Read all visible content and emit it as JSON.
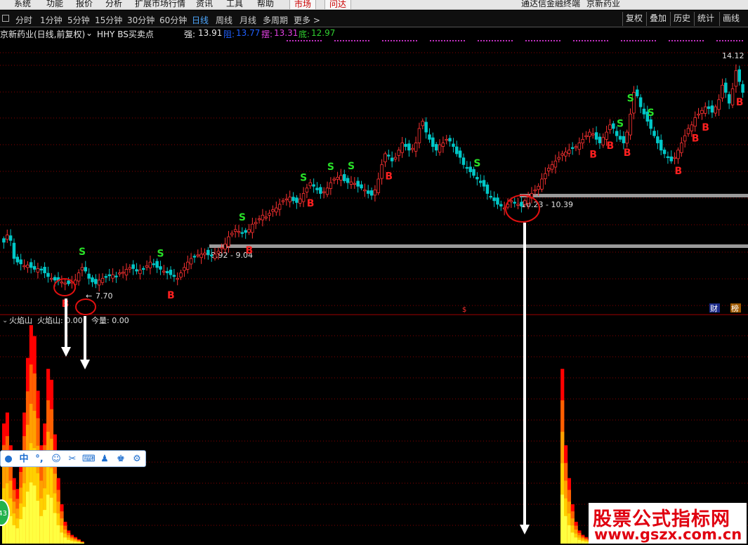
{
  "menu": {
    "items": [
      "系统",
      "功能",
      "报价",
      "分析",
      "扩展市场行情",
      "资讯",
      "工具",
      "帮助"
    ],
    "tabs": [
      "市场",
      "问达"
    ],
    "app_title": "通达信金融终端",
    "stock_name": "京新药业"
  },
  "period_bar": {
    "periods": [
      "分时",
      "1分钟",
      "5分钟",
      "15分钟",
      "30分钟",
      "60分钟",
      "日线",
      "周线",
      "月线",
      "多周期",
      "更多 >"
    ],
    "active": "日线",
    "tools": [
      "复权",
      "叠加",
      "历史",
      "统计",
      "画线"
    ]
  },
  "info": {
    "title": "京新药业(日线,前复权)",
    "indicator": "HHY BS买卖点",
    "strong_label": "强:",
    "strong_value": "13.91",
    "resist_label": "阻:",
    "resist_value": "13.77",
    "swing_label": "摆:",
    "swing_value": "13.31",
    "bottom_label": "底:",
    "bottom_value": "12.97"
  },
  "price_chart": {
    "high_label": "14.12",
    "low_label": "7.70",
    "zones": [
      {
        "label": "8.92 - 9.04"
      },
      {
        "label": "10.23 - 10.39"
      }
    ],
    "signal_marks": {
      "buy": "B",
      "sell": "S"
    },
    "dollar_mark": "$",
    "finance_badge": "财",
    "rank_badge": "榜"
  },
  "lower_panel": {
    "name": "火焰山",
    "line_label": "火焰山: 0.00",
    "volume_label": "今量: 0.00"
  },
  "watermark": {
    "title": "股票公式指标网",
    "url": "www.gszx.com.cn"
  },
  "float_toolbar": {
    "ball_text": "43",
    "middle_label": "中"
  },
  "colors": {
    "up": "#ff3232",
    "down": "#00c8c8",
    "buy": "#ff2020",
    "sell": "#28e028",
    "zone_bar": "#9a9a9a",
    "grid": "#8a0000"
  },
  "chart_data": {
    "type": "candlestick",
    "series": [
      {
        "name": "price",
        "close": [
          9.05,
          9.25,
          9.1,
          8.6,
          8.5,
          8.45,
          8.4,
          8.42,
          8.35,
          8.3,
          8.32,
          8.28,
          8.2,
          8.1,
          8.05,
          8.0,
          7.98,
          7.95,
          7.92,
          7.9,
          7.95,
          8.0,
          8.2,
          8.35,
          8.25,
          8.05,
          7.95,
          7.9,
          8.0,
          8.05,
          8.1,
          8.12,
          8.15,
          8.1,
          8.2,
          8.22,
          8.3,
          8.35,
          8.32,
          8.25,
          8.28,
          8.3,
          8.4,
          8.5,
          8.45,
          8.35,
          8.3,
          8.25,
          8.2,
          8.15,
          8.1,
          8.05,
          8.2,
          8.35,
          8.5,
          8.6,
          8.65,
          8.7,
          8.72,
          8.75,
          8.7,
          8.68,
          8.72,
          8.8,
          8.9,
          9.0,
          9.2,
          9.3,
          9.4,
          9.35,
          9.3,
          9.32,
          9.4,
          9.55,
          9.6,
          9.7,
          9.8,
          9.75,
          9.85,
          9.95,
          10.0,
          10.1,
          10.2,
          10.25,
          10.3,
          10.2,
          10.15,
          10.25,
          10.4,
          10.55,
          10.7,
          10.6,
          10.5,
          10.4,
          10.45,
          10.55,
          10.7,
          10.8,
          10.85,
          10.9,
          10.75,
          10.7,
          10.72,
          10.68,
          10.6,
          10.55,
          10.5,
          10.4,
          10.35,
          10.5,
          10.8,
          11.2,
          11.5,
          11.45,
          11.3,
          11.4,
          11.6,
          11.8,
          11.7,
          11.6,
          11.65,
          11.8,
          12.2,
          12.4,
          12.1,
          11.9,
          11.7,
          11.6,
          11.75,
          11.8,
          11.9,
          11.85,
          11.7,
          11.5,
          11.4,
          11.2,
          11.1,
          11.0,
          10.9,
          10.8,
          10.7,
          10.6,
          10.4,
          10.3,
          10.2,
          10.1,
          10.05,
          10.0,
          10.1,
          10.2,
          10.15,
          10.1,
          10.05,
          10.2,
          10.3,
          10.4,
          10.5,
          10.6,
          10.8,
          10.95,
          11.1,
          11.2,
          11.3,
          11.4,
          11.5,
          11.55,
          11.6,
          11.65,
          11.7,
          11.8,
          11.9,
          12.0,
          12.1,
          12.05,
          11.9,
          11.8,
          11.95,
          12.1,
          12.3,
          12.2,
          12.0,
          11.9,
          11.8,
          12.1,
          12.6,
          13.2,
          13.1,
          12.8,
          12.6,
          12.4,
          12.2,
          12.0,
          11.8,
          11.6,
          11.5,
          11.4,
          11.3,
          11.4,
          11.6,
          11.8,
          12.0,
          12.2,
          12.3,
          12.5,
          12.6,
          12.7,
          12.8,
          12.75,
          12.65,
          12.8,
          13.0,
          13.4,
          13.2,
          12.9,
          13.3,
          13.8,
          13.5,
          13.2
        ]
      },
      {
        "name": "火焰山",
        "values": [
          0.55,
          0.6,
          0.45,
          0.3,
          0.25,
          0.4,
          0.6,
          0.85,
          1.0,
          0.95,
          0.7,
          0.45,
          0.55,
          0.8,
          0.75,
          0.5,
          0.3,
          0.18,
          0.1,
          0.06,
          0.04,
          0.03,
          0.02,
          0.01,
          0,
          0,
          0,
          0,
          0,
          0,
          0,
          0,
          0,
          0,
          0,
          0,
          0,
          0,
          0,
          0,
          0,
          0,
          0,
          0,
          0,
          0,
          0,
          0,
          0,
          0,
          0,
          0,
          0,
          0,
          0,
          0,
          0,
          0,
          0,
          0,
          0,
          0,
          0,
          0,
          0,
          0,
          0,
          0,
          0,
          0,
          0,
          0,
          0,
          0,
          0,
          0,
          0,
          0,
          0,
          0,
          0,
          0,
          0,
          0,
          0,
          0,
          0,
          0,
          0,
          0,
          0,
          0,
          0,
          0,
          0,
          0,
          0,
          0,
          0,
          0,
          0,
          0,
          0,
          0,
          0,
          0,
          0,
          0,
          0,
          0,
          0,
          0,
          0,
          0,
          0,
          0,
          0,
          0,
          0,
          0,
          0,
          0,
          0,
          0,
          0,
          0,
          0,
          0,
          0,
          0,
          0,
          0,
          0,
          0,
          0,
          0,
          0,
          0,
          0,
          0,
          0,
          0,
          0,
          0,
          0,
          0,
          0,
          0,
          0,
          0,
          0,
          0,
          0,
          0,
          0,
          0,
          0,
          0,
          0,
          0,
          0,
          0,
          0,
          0,
          0.8,
          0.45,
          0.3,
          0.18,
          0.1,
          0.06,
          0.04,
          0.03,
          0.02,
          0.01,
          0.01,
          0,
          0,
          0,
          0,
          0,
          0,
          0,
          0,
          0,
          0,
          0,
          0,
          0,
          0,
          0,
          0,
          0,
          0,
          0,
          0,
          0,
          0,
          0,
          0,
          0,
          0,
          0,
          0,
          0,
          0,
          0,
          0,
          0,
          0,
          0,
          0,
          0,
          0,
          0,
          0,
          0,
          0,
          0,
          0,
          0,
          0,
          0,
          0,
          0,
          0
        ]
      }
    ],
    "buy_signals": [
      18,
      49,
      72,
      90,
      113,
      173,
      178,
      183,
      198,
      203,
      206,
      216
    ],
    "sell_signals": [
      23,
      46,
      70,
      88,
      96,
      102,
      139,
      181,
      184,
      190
    ]
  }
}
